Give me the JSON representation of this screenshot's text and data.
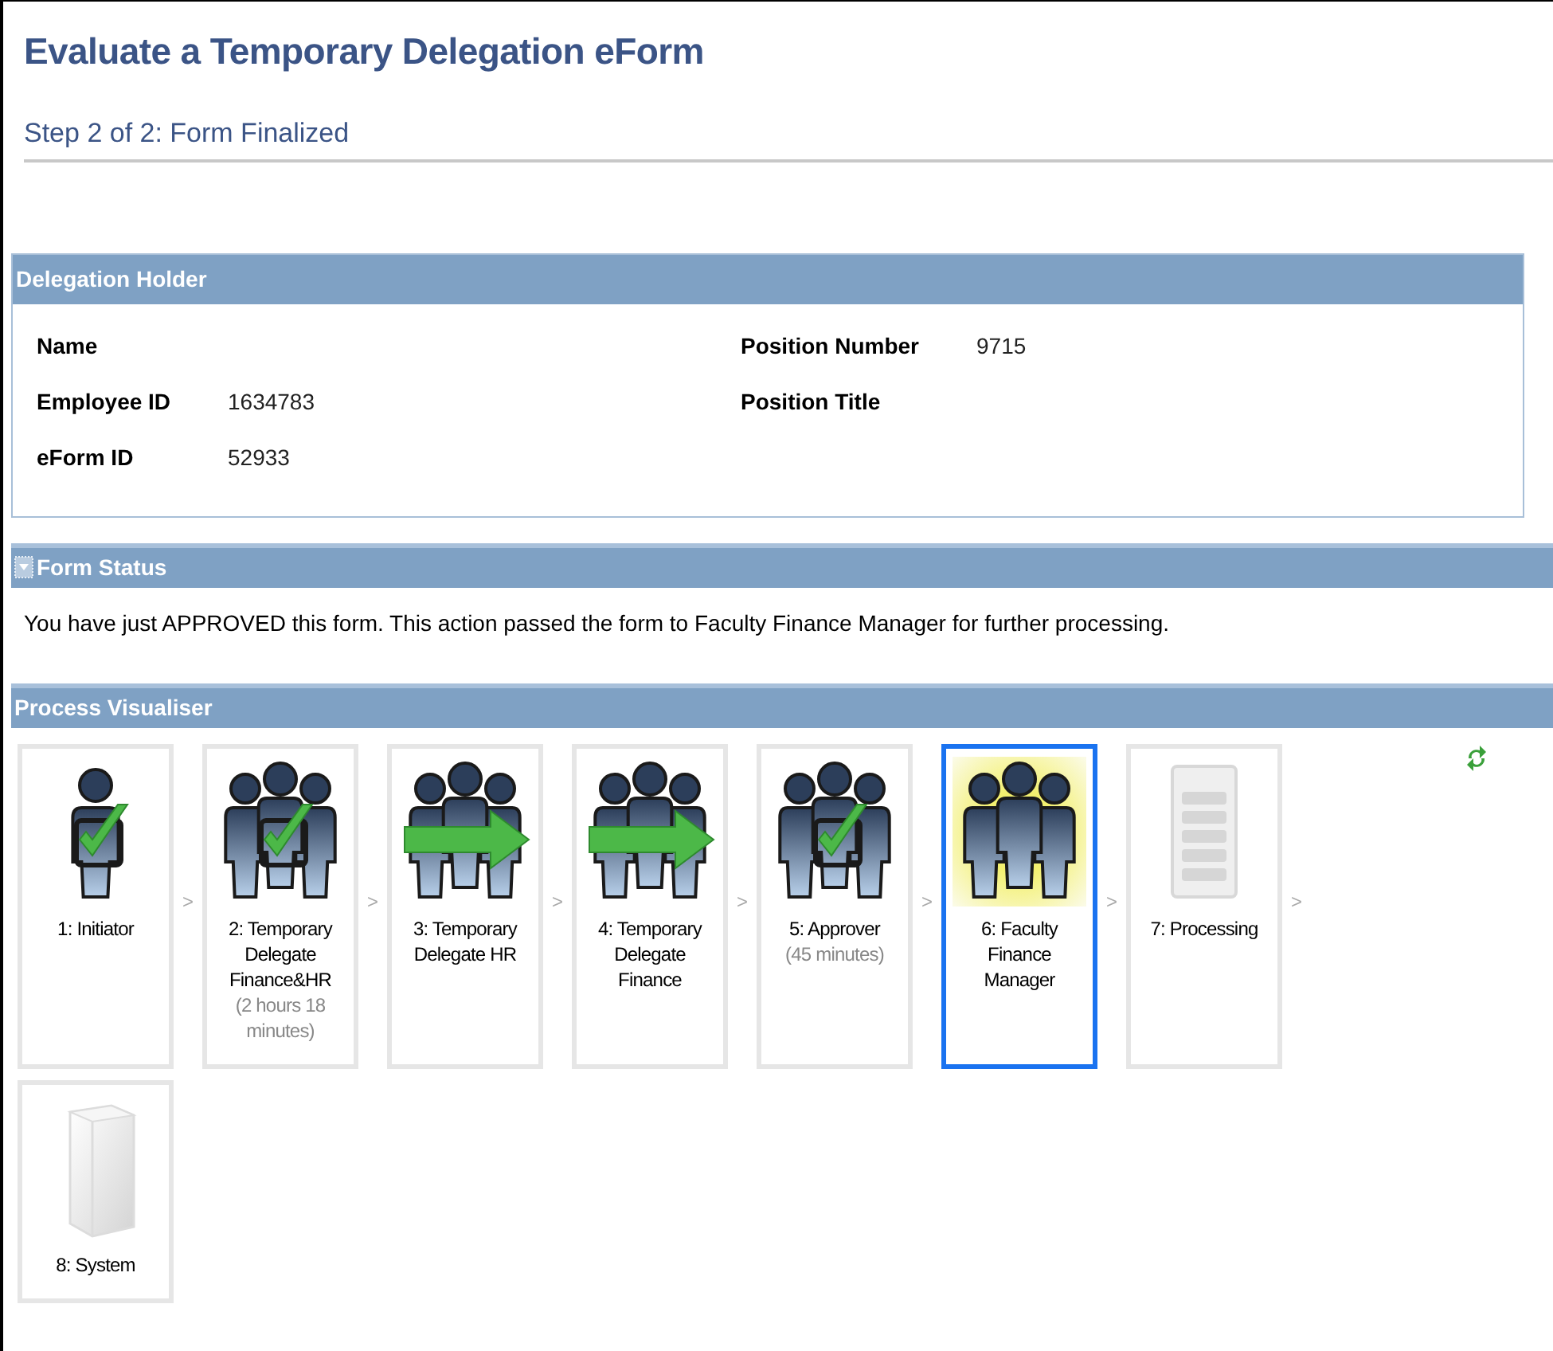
{
  "page": {
    "title": "Evaluate a Temporary Delegation eForm",
    "step": "Step 2 of 2: Form Finalized"
  },
  "delegation_holder": {
    "header": "Delegation Holder",
    "left_fields": [
      {
        "label": "Name"
      },
      {
        "label": "Employee ID",
        "value": "1634783"
      },
      {
        "label": "eForm ID",
        "value": "52933"
      }
    ],
    "right_fields": [
      {
        "label": "Position Number",
        "value": "9715"
      },
      {
        "label": "Position Title"
      }
    ]
  },
  "form_status": {
    "header": "Form Status",
    "message": "You have just APPROVED this form. This action passed the form to Faculty Finance Manager for further processing."
  },
  "process_visualiser": {
    "header": "Process Visualiser",
    "steps": [
      {
        "kind": "person-check",
        "label": "1: Initiator",
        "selected": false,
        "next": ">"
      },
      {
        "kind": "group-check",
        "label": "2: Temporary Delegate Finance&HR",
        "duration": "(2 hours 18 minutes)",
        "selected": false,
        "next": ">"
      },
      {
        "kind": "group-arrow",
        "label": "3: Temporary Delegate HR",
        "selected": false,
        "next": ">"
      },
      {
        "kind": "group-arrow",
        "label": "4: Temporary Delegate Finance",
        "selected": false,
        "next": ">"
      },
      {
        "kind": "group-check",
        "label": "5: Approver",
        "duration": "(45 minutes)",
        "selected": false,
        "next": ">"
      },
      {
        "kind": "group-current",
        "label": "6: Faculty Finance Manager",
        "selected": true,
        "next": ">"
      },
      {
        "kind": "processing",
        "label": "7: Processing",
        "selected": false,
        "next": ">"
      },
      {
        "kind": "system",
        "label": "8: System",
        "selected": false
      }
    ]
  }
}
